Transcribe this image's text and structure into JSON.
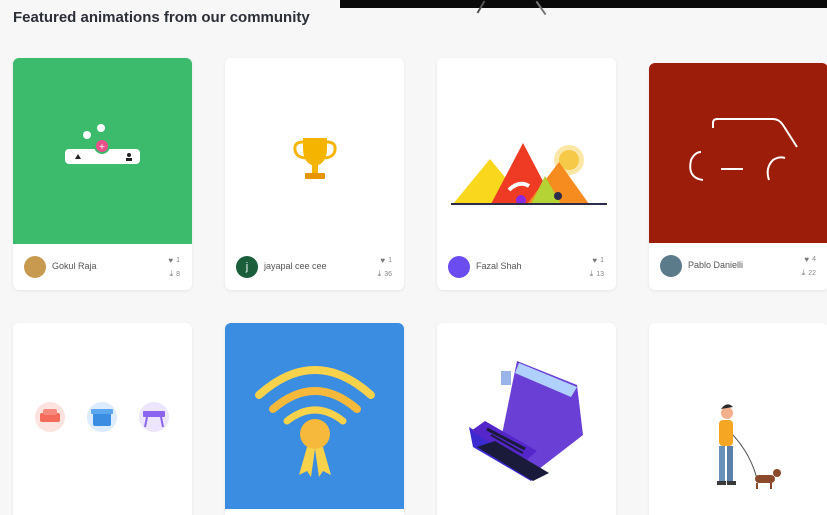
{
  "section": {
    "heading": "Featured animations from our community"
  },
  "cards": [
    {
      "author": "Gokul Raja",
      "likes": "1",
      "downloads": "8",
      "thumb_bg": "#3dbb6c",
      "avatar_color": "#c89a4f"
    },
    {
      "author": "jayapal cee cee",
      "avatar_initial": "j",
      "likes": "1",
      "downloads": "36",
      "thumb_bg": "#ffffff",
      "avatar_color": "#1a5e3c"
    },
    {
      "author": "Fazal Shah",
      "likes": "1",
      "downloads": "13",
      "thumb_bg": "#ffffff",
      "avatar_color": "#6b4cf0"
    },
    {
      "author": "Pablo Danielli",
      "likes": "4",
      "downloads": "22",
      "thumb_bg": "#9b1d0a",
      "avatar_color": "#5b7a8a"
    },
    {
      "thumb_bg": "#ffffff"
    },
    {
      "thumb_bg": "#3a8de0"
    },
    {
      "thumb_bg": "#ffffff"
    },
    {
      "thumb_bg": "#ffffff"
    }
  ],
  "icons": {
    "like": "heart-icon",
    "download": "download-icon"
  }
}
